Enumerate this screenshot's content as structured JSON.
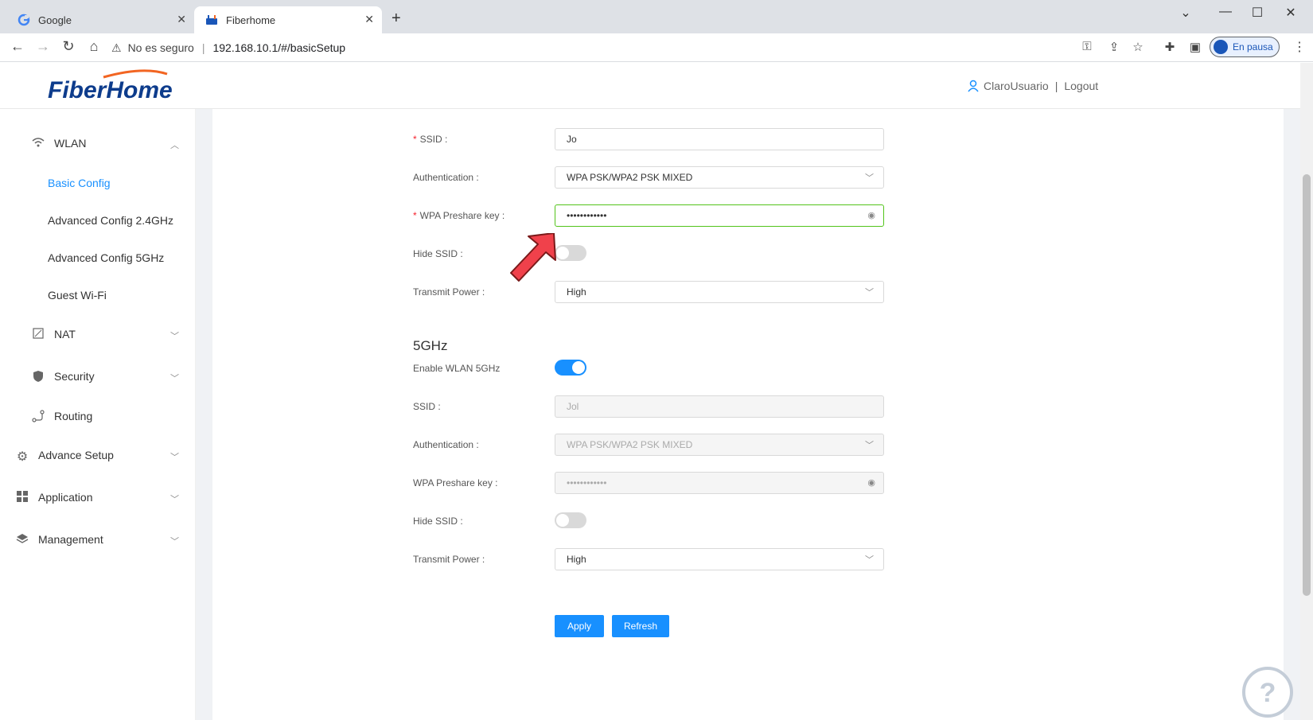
{
  "browser": {
    "tabs": [
      {
        "title": "Google",
        "icon": "google-favicon"
      },
      {
        "title": "Fiberhome",
        "icon": "fiberhome-favicon"
      }
    ],
    "security_label": "No es seguro",
    "url": "192.168.10.1/#/basicSetup",
    "profile_label": "En pausa"
  },
  "header": {
    "logo_text": "FiberHome",
    "username": "ClaroUsuario",
    "separator": "|",
    "logout": "Logout"
  },
  "sidebar": {
    "wlan": "WLAN",
    "basic_config": "Basic Config",
    "advanced_24": "Advanced Config 2.4GHz",
    "advanced_5": "Advanced Config 5GHz",
    "guest": "Guest Wi-Fi",
    "nat": "NAT",
    "security": "Security",
    "routing": "Routing",
    "advance_setup": "Advance Setup",
    "application": "Application",
    "management": "Management"
  },
  "band24": {
    "ssid_label": "SSID :",
    "ssid_value": "Jo",
    "auth_label": "Authentication :",
    "auth_value": "WPA PSK/WPA2 PSK MIXED",
    "key_label": "WPA Preshare key :",
    "key_value": "••••••••••••",
    "hide_label": "Hide SSID :",
    "power_label": "Transmit Power :",
    "power_value": "High"
  },
  "band5": {
    "title": "5GHz",
    "enable_label": "Enable WLAN 5GHz",
    "ssid_label": "SSID :",
    "ssid_value": "Jol",
    "auth_label": "Authentication :",
    "auth_value": "WPA PSK/WPA2 PSK MIXED",
    "key_label": "WPA Preshare key :",
    "key_value": "••••••••••••",
    "hide_label": "Hide SSID :",
    "power_label": "Transmit Power :",
    "power_value": "High"
  },
  "buttons": {
    "apply": "Apply",
    "refresh": "Refresh"
  },
  "colors": {
    "accent": "#1890ff",
    "focus_border": "#52c41a",
    "brand_blue": "#0d3c8c",
    "brand_orange": "#f26522",
    "annotation_arrow": "#f0414b"
  }
}
